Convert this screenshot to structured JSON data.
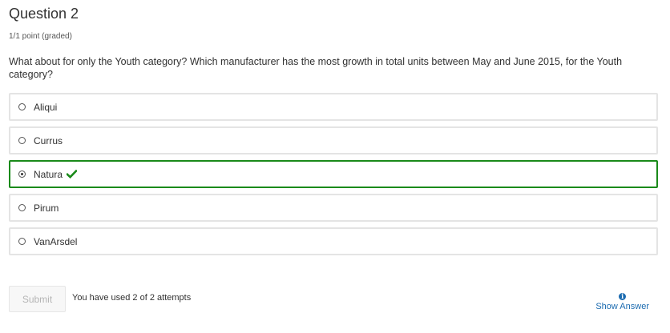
{
  "question": {
    "title": "Question 2",
    "points": "1/1 point (graded)",
    "text": "What about for only the Youth category? Which manufacturer has the most growth in total units between May and June 2015, for the Youth category?"
  },
  "options": [
    {
      "label": "Aliqui",
      "selected": false,
      "correct": false
    },
    {
      "label": "Currus",
      "selected": false,
      "correct": false
    },
    {
      "label": "Natura",
      "selected": true,
      "correct": true
    },
    {
      "label": "Pirum",
      "selected": false,
      "correct": false
    },
    {
      "label": "VanArsdel",
      "selected": false,
      "correct": false
    }
  ],
  "footer": {
    "submit_label": "Submit",
    "attempts_text": "You have used 2 of 2 attempts",
    "show_answer_label": "Show Answer"
  },
  "icons": {
    "correct": "checkmark-icon",
    "info": "info-icon"
  },
  "colors": {
    "correct_border": "#1a8a1a",
    "checkmark": "#1a8a1a",
    "link": "#1b6bb0"
  }
}
